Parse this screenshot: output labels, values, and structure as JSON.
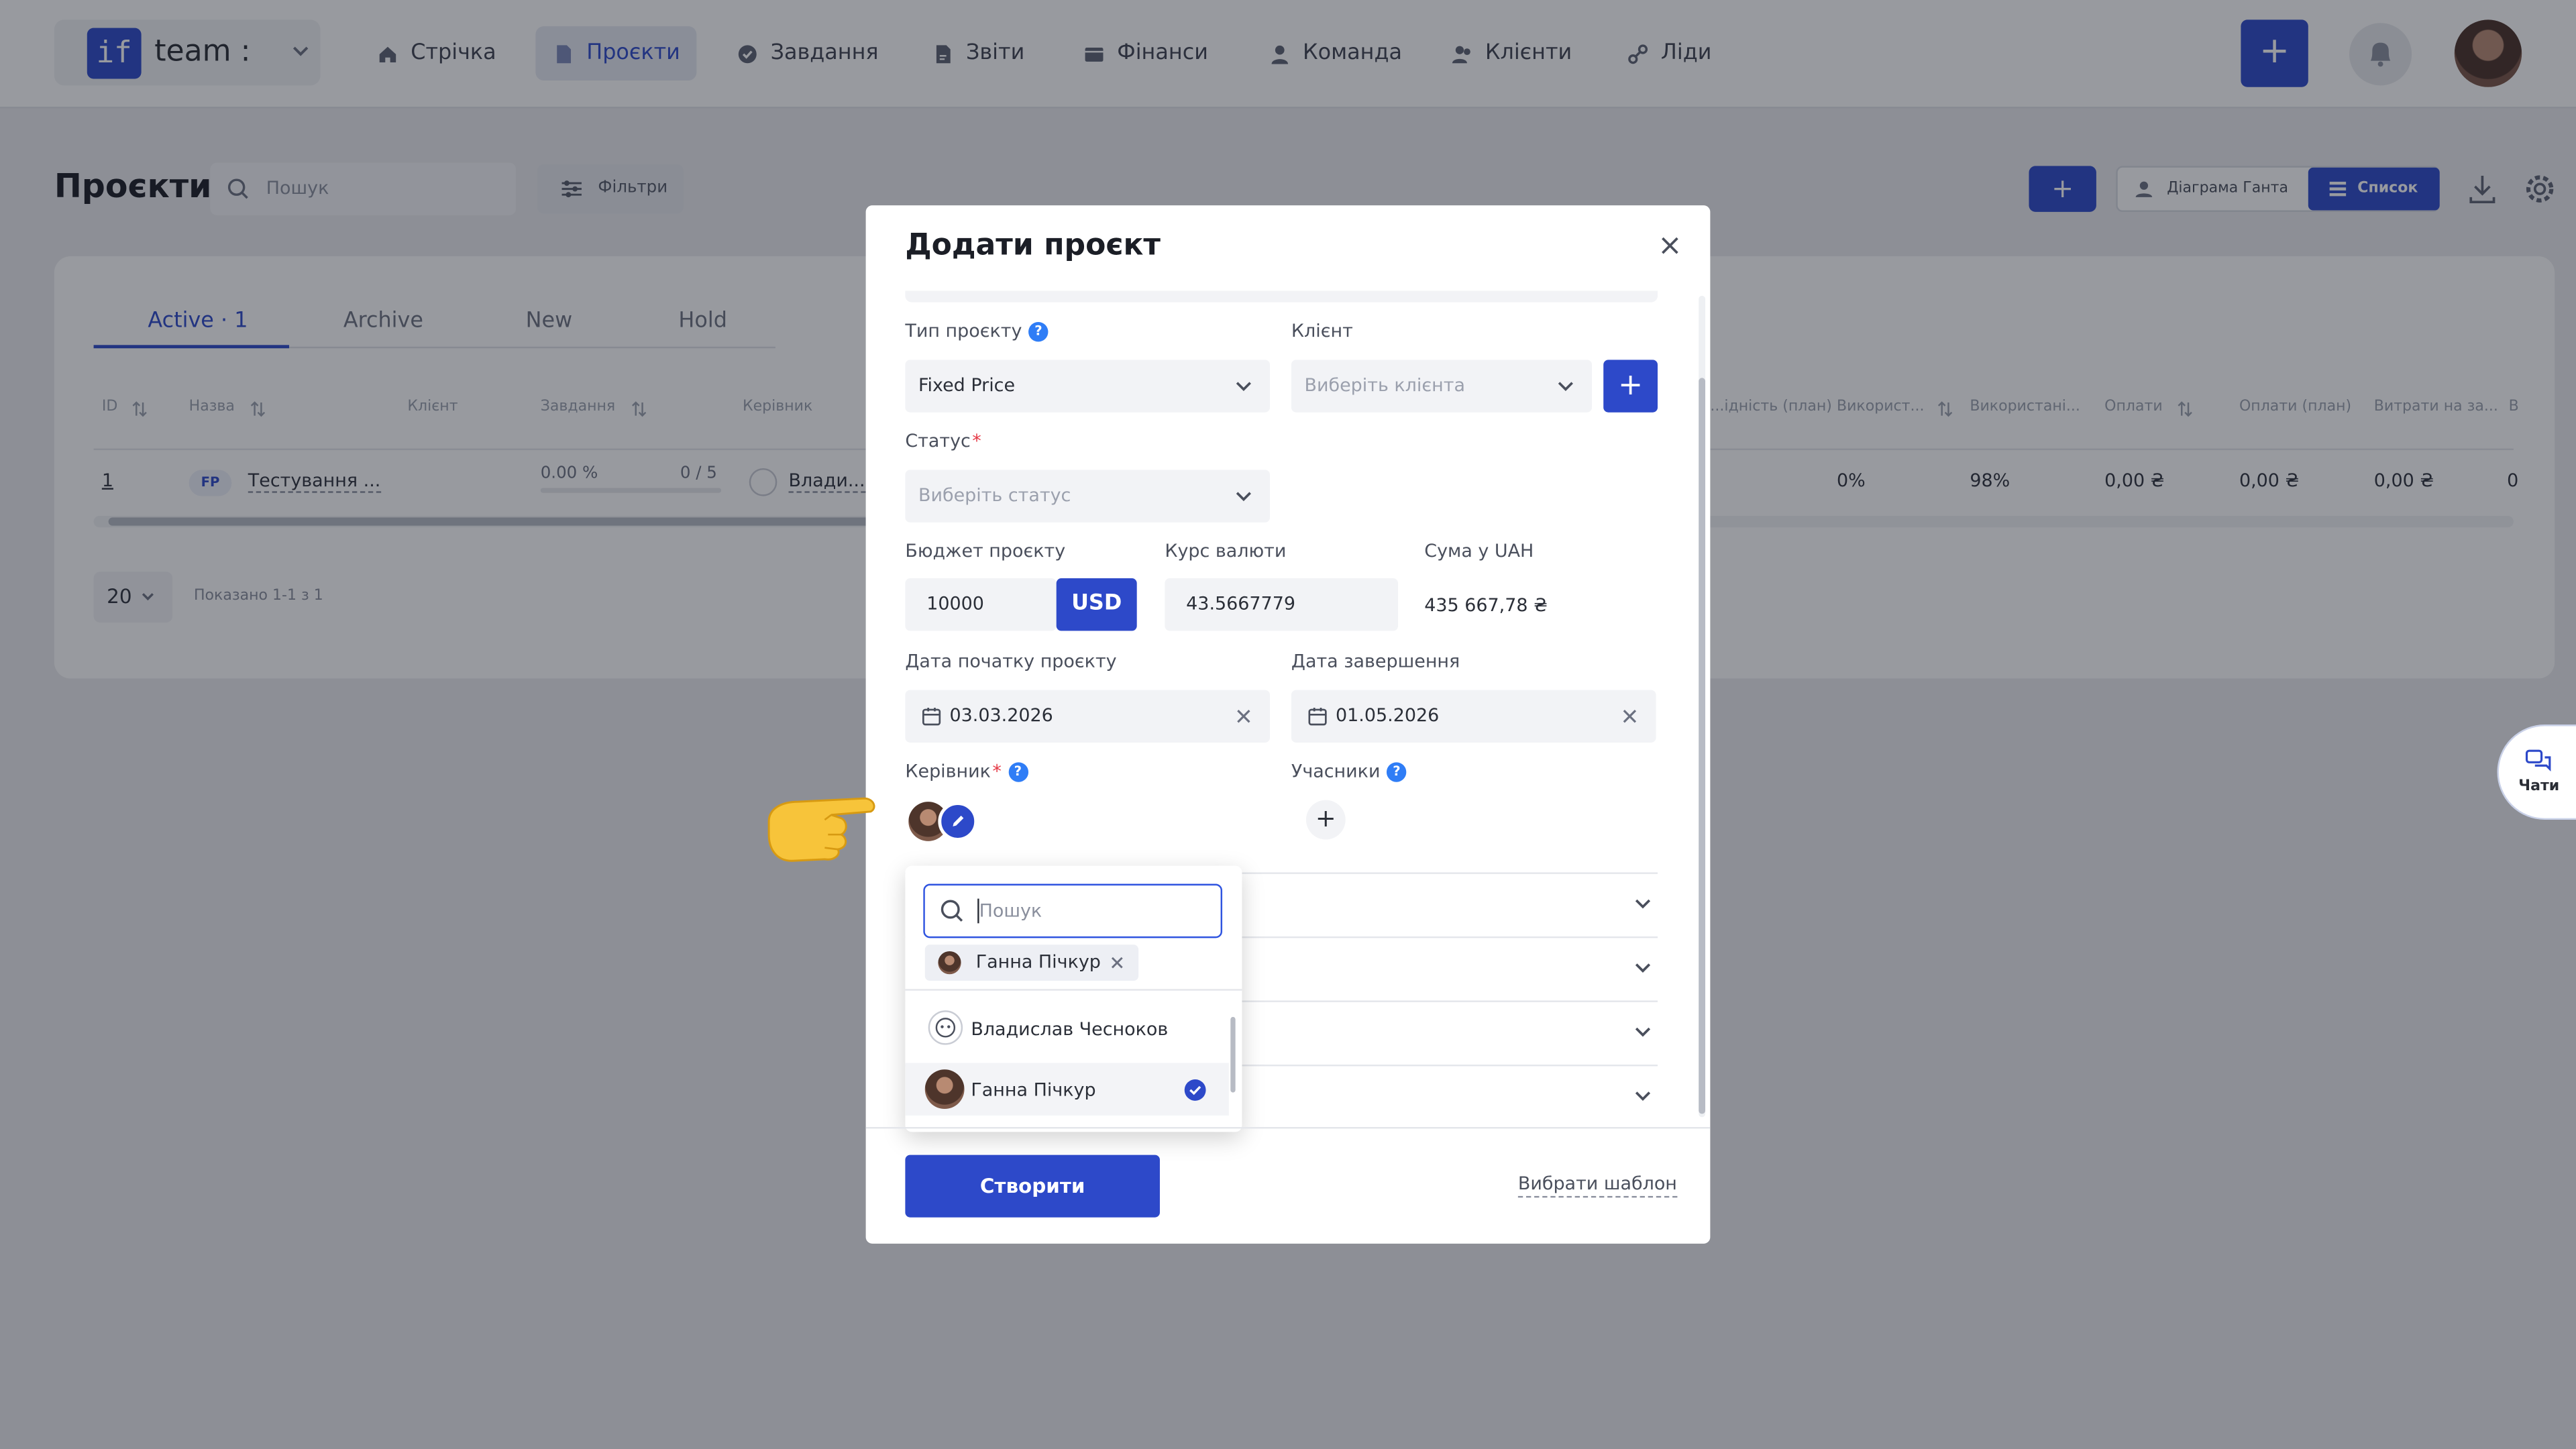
{
  "app": {
    "brand": "team :",
    "logo": "if",
    "nav": [
      {
        "label": "Стрічка",
        "icon": "home-icon"
      },
      {
        "label": "Проєкти",
        "icon": "document-icon",
        "active": true
      },
      {
        "label": "Завдання",
        "icon": "check-circle-icon"
      },
      {
        "label": "Звіти",
        "icon": "report-icon"
      },
      {
        "label": "Фінанси",
        "icon": "finance-icon"
      },
      {
        "label": "Команда",
        "icon": "person-icon"
      },
      {
        "label": "Клієнти",
        "icon": "clients-icon"
      },
      {
        "label": "Ліди",
        "icon": "leads-icon"
      }
    ],
    "add_label": "+"
  },
  "page": {
    "title": "Проєкти",
    "search_placeholder": "Пошук",
    "filters": "Фільтри",
    "gantt": "Діаграма Ганта",
    "list": "Список",
    "chats": "Чати",
    "tabs": [
      "Active · 1",
      "Archive",
      "New",
      "Hold"
    ],
    "columns": [
      "ID",
      "Назва",
      "Клієнт",
      "Завдання",
      "Керівник",
      "...ідність (план)",
      "Використ...",
      "Використані...",
      "Оплати",
      "Оплати (план)",
      "Витрати на за...",
      "В"
    ],
    "row": {
      "id": "1",
      "badge": "FP",
      "name": "Тестування ...",
      "tasks_percent": "0.00 %",
      "tasks_count": "0 / 5",
      "manager": "Влади...",
      "used1": "0%",
      "used2": "98%",
      "pay": "0,00 ₴",
      "pay_plan": "0,00 ₴",
      "costs": "0,00 ₴",
      "last": "0"
    },
    "page_size": "20",
    "shown": "Показано 1-1 з 1"
  },
  "modal": {
    "title": "Додати проєкт",
    "project_type_label": "Тип проєкту",
    "project_type_value": "Fixed Price",
    "client_label": "Клієнт",
    "client_placeholder": "Виберіть клієнта",
    "status_label": "Статус",
    "status_placeholder": "Виберіть статус",
    "budget_label": "Бюджет проєкту",
    "budget_value": "10000",
    "currency": "USD",
    "rate_label": "Курс валюти",
    "rate_value": "43.5667779",
    "uah_label": "Сума у UAH",
    "uah_value": "435 667,78 ₴",
    "start_label": "Дата початку проєкту",
    "start_value": "03.03.2026",
    "end_label": "Дата завершення",
    "end_value": "01.05.2026",
    "manager_label": "Керівник",
    "participants_label": "Учасники",
    "dropdown": {
      "search_placeholder": "Пошук",
      "selected_chip": "Ганна Пічкур",
      "options": [
        "Владислав Чесноков",
        "Ганна Пічкур"
      ]
    },
    "create": "Створити",
    "template": "Вибрати шаблон"
  },
  "colors": {
    "accent": "#2d49c9",
    "help": "#2f7df6"
  }
}
